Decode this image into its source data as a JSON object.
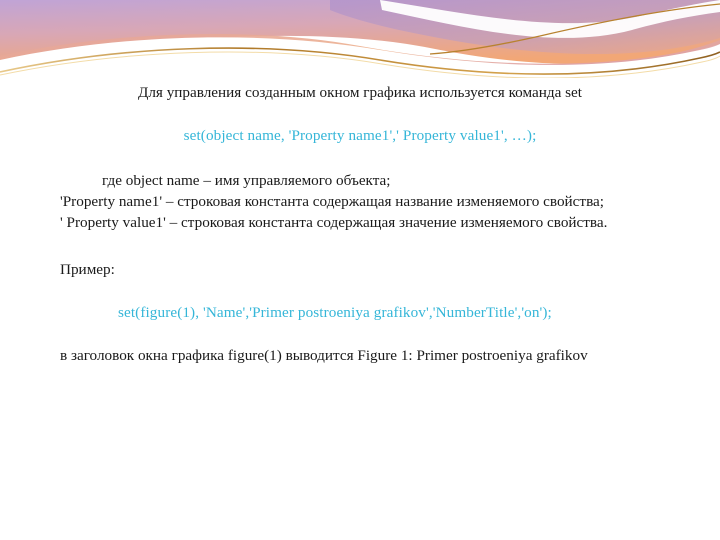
{
  "slide": {
    "background_color": "#ffffff",
    "text_color": "#1a1a1a",
    "code_color": "#35b6d8",
    "decor": {
      "gradient_top_color": "#c3a8d4",
      "gradient_mid_color": "#d9a9b4",
      "gradient_bottom_color": "#f0a878",
      "band_purple": "#b79ccb",
      "band_salmon": "#e8a48f",
      "band_pink": "#dfa0ac",
      "gold_line": "#c8923c",
      "white_swoosh": "#ffffff"
    }
  },
  "body": {
    "intro": "Для управления созданным окном графика используется команда set",
    "syntax_code": "set(object name, 'Property name1',' Property value1', …);",
    "definition_object": "где object name – имя управляемого объекта;",
    "definition_name": "'Property name1' – строковая константа содержащая название изменяемого свойства;",
    "definition_value": "' Property value1' – строковая константа содержащая значение изменяемого свойства.",
    "example_label": "Пример:",
    "example_code": "set(figure(1), 'Name','Primer postroeniya grafikov','NumberTitle','on');",
    "example_result": "в заголовок окна графика figure(1) выводится Figure 1: Primer postroeniya grafikov"
  }
}
